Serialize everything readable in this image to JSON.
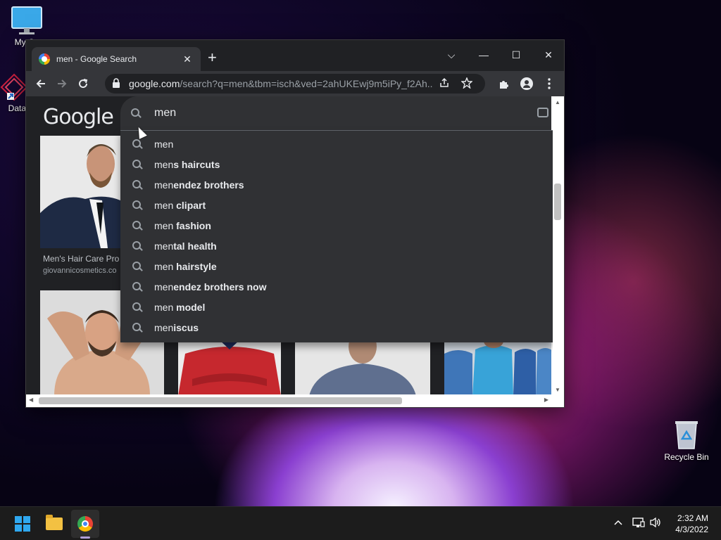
{
  "desktop": {
    "icons": [
      {
        "label": "My Co"
      },
      {
        "label": "DataW"
      },
      {
        "label": "Recycle Bin"
      }
    ]
  },
  "browser": {
    "tab_title": "men - Google Search",
    "tab_close": "✕",
    "new_tab": "+",
    "window_controls": {
      "dropdown": "⌵",
      "minimize": "—",
      "maximize": "☐",
      "close": "✕"
    },
    "url_host": "google.com",
    "url_path": "/search?q=men&tbm=isch&ved=2ahUKEwj9m5iPy_f2Ah...",
    "toolbar_icons": [
      "back-icon",
      "forward-icon",
      "reload-icon",
      "lock-icon",
      "share-icon",
      "star-icon",
      "extensions-icon",
      "profile-icon",
      "menu-icon"
    ]
  },
  "google": {
    "logo": "Google",
    "search_query": "men",
    "suggestions": [
      {
        "typed": "men",
        "completion": ""
      },
      {
        "typed": "men",
        "completion": "s haircuts"
      },
      {
        "typed": "men",
        "completion": "endez brothers"
      },
      {
        "typed": "men",
        "completion": " clipart"
      },
      {
        "typed": "men",
        "completion": " fashion"
      },
      {
        "typed": "men",
        "completion": "tal health"
      },
      {
        "typed": "men",
        "completion": " hairstyle"
      },
      {
        "typed": "men",
        "completion": "endez brothers now"
      },
      {
        "typed": "men",
        "completion": " model"
      },
      {
        "typed": "men",
        "completion": "iscus"
      }
    ],
    "results": [
      {
        "caption": "Men's Hair Care Pro",
        "source": "giovannicosmetics.co"
      }
    ]
  },
  "taskbar": {
    "time": "2:32 AM",
    "date": "4/3/2022",
    "tray_chevron": "^",
    "pinned": [
      "start-icon",
      "file-explorer-icon",
      "chrome-icon"
    ]
  },
  "colors": {
    "browser_bg": "#202124",
    "suggest_bg": "#303134",
    "text": "#e8eaed",
    "windows_accent": "#2fa8f0"
  }
}
